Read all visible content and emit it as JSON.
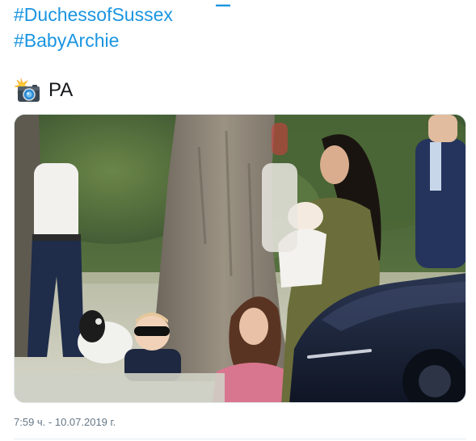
{
  "tweet": {
    "hashtags": [
      "#DuchessofSussex",
      "#BabyArchie"
    ],
    "credit": {
      "icon": "camera-with-flash-icon",
      "text": "PA"
    },
    "photo": {
      "description_alt": "",
      "colors": {
        "foliage": "#4d6a3a",
        "trunk": "#8a8174",
        "dress": "#6b6e3a",
        "car": "#1c2436"
      }
    },
    "timestamp": "7:59 ч. - 10.07.2019 г."
  },
  "colors": {
    "link": "#1b95e0",
    "text": "#14171a",
    "muted": "#657786",
    "border": "#e6ecf0"
  }
}
